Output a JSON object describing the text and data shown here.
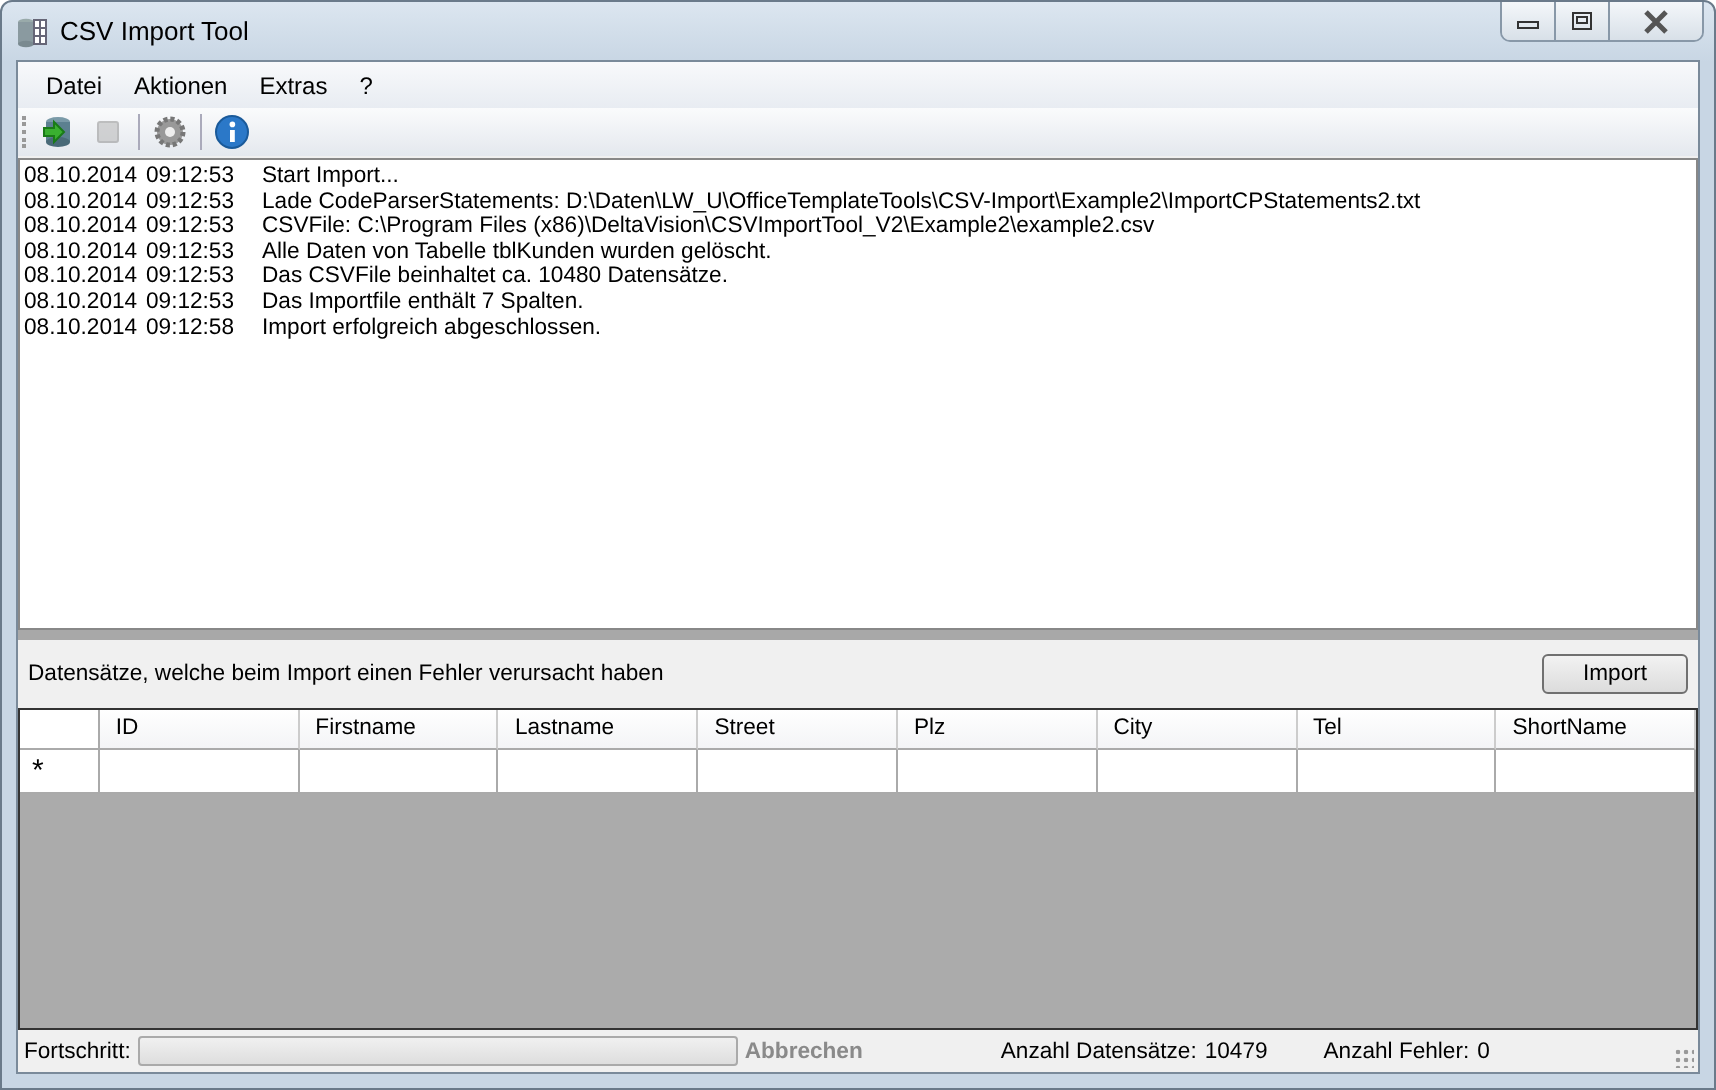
{
  "window": {
    "title": "CSV Import Tool"
  },
  "menu": [
    "Datei",
    "Aktionen",
    "Extras",
    "?"
  ],
  "toolbar": [
    {
      "kind": "import",
      "disabled": false
    },
    {
      "kind": "stop",
      "disabled": true
    },
    {
      "kind": "separator"
    },
    {
      "kind": "settings",
      "disabled": false
    },
    {
      "kind": "separator"
    },
    {
      "kind": "info",
      "disabled": false
    }
  ],
  "log": [
    {
      "date": "08.10.2014",
      "time": "09:12:53",
      "message": "Start Import..."
    },
    {
      "date": "08.10.2014",
      "time": "09:12:53",
      "message": "Lade CodeParserStatements: D:\\Daten\\LW_U\\OfficeTemplateTools\\CSV-Import\\Example2\\ImportCPStatements2.txt"
    },
    {
      "date": "08.10.2014",
      "time": "09:12:53",
      "message": "CSVFile: C:\\Program Files (x86)\\DeltaVision\\CSVImportTool_V2\\Example2\\example2.csv"
    },
    {
      "date": "08.10.2014",
      "time": "09:12:53",
      "message": "Alle Daten von Tabelle tblKunden wurden gelöscht."
    },
    {
      "date": "08.10.2014",
      "time": "09:12:53",
      "message": "Das CSVFile beinhaltet ca. 10480 Datensätze."
    },
    {
      "date": "08.10.2014",
      "time": "09:12:53",
      "message": "Das Importfile enthält 7 Spalten."
    },
    {
      "date": "08.10.2014",
      "time": "09:12:58",
      "message": "Import erfolgreich abgeschlossen."
    }
  ],
  "errors_panel": {
    "label": "Datensätze, welche beim Import einen Fehler verursacht haben",
    "button": "Import"
  },
  "table": {
    "columns": [
      "ID",
      "Firstname",
      "Lastname",
      "Street",
      "Plz",
      "City",
      "Tel",
      "ShortName"
    ],
    "new_row_marker": "*"
  },
  "status_bar": {
    "progress_label": "Fortschritt:",
    "progress": {
      "level": 0
    },
    "cancel": {
      "label": "Abbrechen",
      "disabled": true
    },
    "records_label": "Anzahl Datensätze:",
    "records": "10479",
    "errors_label": "Anzahl Fehler:",
    "errors": "0"
  }
}
